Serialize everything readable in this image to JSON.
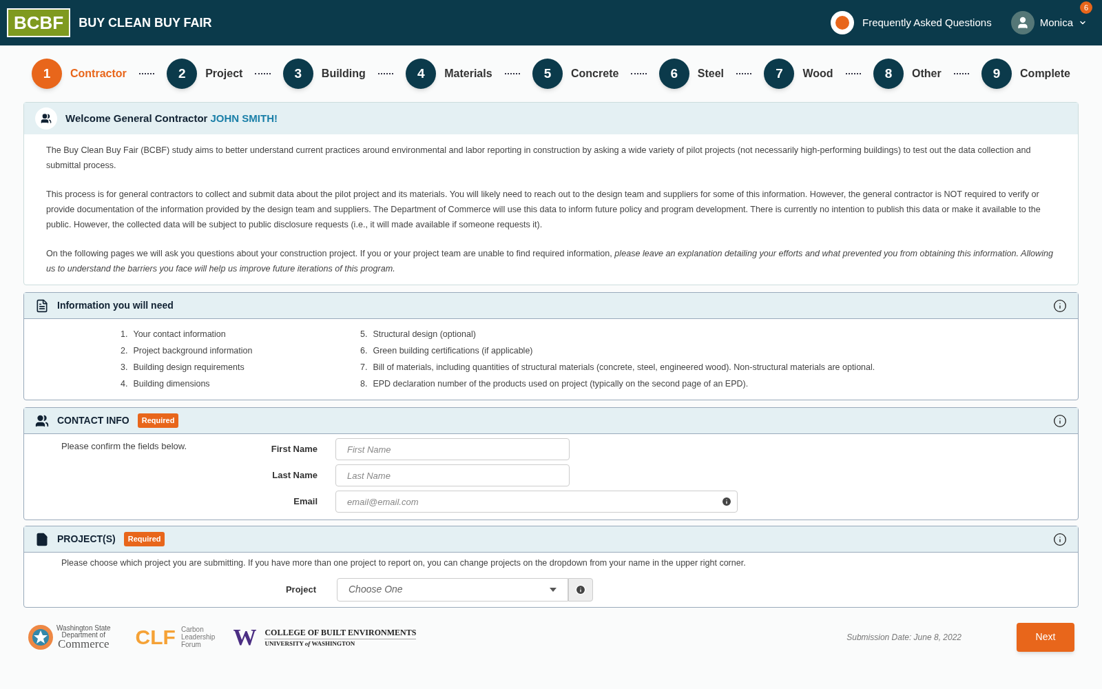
{
  "header": {
    "logo": "BCBF",
    "title": "BUY CLEAN BUY FAIR",
    "faq": "Frequently Asked Questions",
    "user": "Monica",
    "notification_count": "6"
  },
  "steps": [
    {
      "number": "1",
      "label": "Contractor",
      "selected": true
    },
    {
      "number": "2",
      "label": "Project",
      "selected": false
    },
    {
      "number": "3",
      "label": "Building",
      "selected": false
    },
    {
      "number": "4",
      "label": "Materials",
      "selected": false
    },
    {
      "number": "5",
      "label": "Concrete",
      "selected": false
    },
    {
      "number": "6",
      "label": "Steel",
      "selected": false
    },
    {
      "number": "7",
      "label": "Wood",
      "selected": false
    },
    {
      "number": "8",
      "label": "Other",
      "selected": false
    },
    {
      "number": "9",
      "label": "Complete",
      "selected": false
    }
  ],
  "welcome": {
    "greeting": "Welcome General Contractor",
    "name": "JOHN SMITH!",
    "paragraphs": [
      "The Buy Clean Buy Fair (BCBF) study aims to better understand current practices around environmental and labor reporting in construction by asking a wide variety of pilot projects (not necessarily high-performing buildings) to test out the data collection and submittal process.",
      "This process is for general contractors to collect and submit data about the pilot project and its materials.  You will likely need to reach out to the design team and suppliers for some of this information. However, the general contractor is NOT required to verify or provide documentation of the information provided by the design team and suppliers.   The Department of Commerce will use this data to inform future policy and program development.  There is currently no intention to publish this data or make it available to the public.  However, the collected data will be subject to public disclosure requests (i.e., it will made available if someone requests it).",
      "On the following pages we will ask you questions about your construction project.  If you or your project team are unable to find required information, *please leave an explanation detailing your efforts and what prevented you from obtaining this information. Allowing us to understand the barriers you face will help us improve future iterations of this program.*"
    ]
  },
  "info_needed": {
    "title": "Information you will need",
    "items": [
      {
        "number": "1.",
        "text": "Your contact information"
      },
      {
        "number": "2.",
        "text": "Project background information"
      },
      {
        "number": "3.",
        "text": "Building design requirements"
      },
      {
        "number": "4.",
        "text": "Building dimensions"
      },
      {
        "number": "5.",
        "text": "Structural design (optional)"
      },
      {
        "number": "6.",
        "text": "Green building certifications (if applicable)"
      },
      {
        "number": "7.",
        "text": "Bill of materials, including quantities of structural materials (concrete, steel, engineered wood). Non-structural materials are optional."
      },
      {
        "number": "8.",
        "text": "EPD declaration number of the products used on project (typically on the second page of an EPD)."
      }
    ]
  },
  "contact_info": {
    "title": "CONTACT INFO",
    "badge": "Required",
    "note": "Please confirm the fields below.",
    "fields": [
      {
        "label": "First Name",
        "placeholder": "First Name",
        "kind": "text"
      },
      {
        "label": "Last Name",
        "placeholder": "Last Name",
        "kind": "text"
      },
      {
        "label": "Email",
        "placeholder": "email@email.com",
        "kind": "email"
      }
    ]
  },
  "projects": {
    "title": "PROJECT(S)",
    "badge": "Required",
    "note": "Please choose which project you are submitting.  If you have more than one project to report on, you can change projects on the dropdown from your name in the upper right corner.",
    "field_label": "Project",
    "placeholder": "Choose One"
  },
  "footer": {
    "commerce": [
      "Washington State",
      "Department of",
      "Commerce"
    ],
    "clf_mark": "CLF",
    "clf": [
      "Carbon",
      "Leadership",
      "Forum"
    ],
    "uw_mark": "W",
    "uw_college": "COLLEGE OF BUILT ENVIRONMENTS",
    "uw_university": "UNIVERSITY *of* WASHINGTON",
    "submission_date": "Submission Date: June 8, 2022",
    "next": "Next"
  }
}
